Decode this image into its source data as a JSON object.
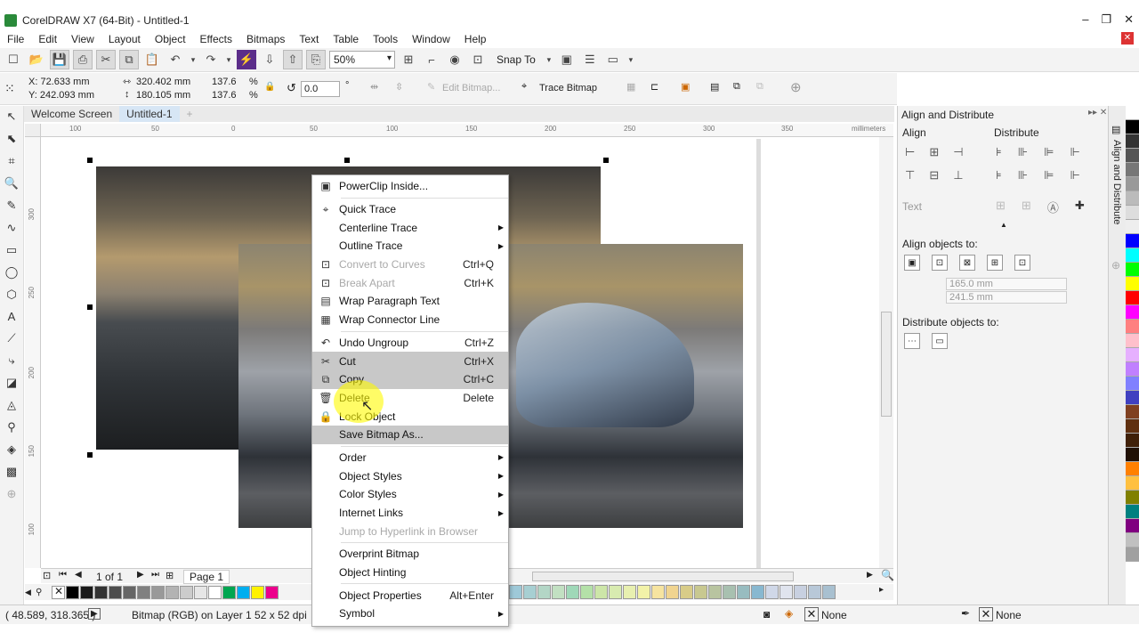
{
  "window": {
    "title": "CorelDRAW X7 (64-Bit) - Untitled-1"
  },
  "menu": [
    "File",
    "Edit",
    "View",
    "Layout",
    "Object",
    "Effects",
    "Bitmaps",
    "Text",
    "Table",
    "Tools",
    "Window",
    "Help"
  ],
  "toolbar": {
    "zoom": "50%",
    "snap_to": "Snap To"
  },
  "property_bar": {
    "x": "X: 72.633 mm",
    "y": "Y: 242.093 mm",
    "width": "320.402 mm",
    "height": "180.105 mm",
    "scale_x": "137.6",
    "scale_y": "137.6",
    "pct": "%",
    "angle": "0.0",
    "deg": "°",
    "edit_bitmap": "Edit Bitmap...",
    "trace_bitmap": "Trace Bitmap"
  },
  "doc_tabs": [
    "Welcome Screen",
    "Untitled-1"
  ],
  "ruler": {
    "h_ticks": [
      "100",
      "50",
      "0",
      "50",
      "100",
      "150",
      "200",
      "250",
      "300",
      "350"
    ],
    "unit": "millimeters",
    "v_ticks": [
      "300",
      "250",
      "200",
      "150",
      "100"
    ],
    "v_unit": "millimeters"
  },
  "page_nav": {
    "counter": "1 of 1",
    "page_tab": "Page 1"
  },
  "context_menu": {
    "items": [
      {
        "label": "PowerClip Inside...",
        "shortcut": "",
        "icon": "powerclip-icon"
      },
      {
        "sep": true
      },
      {
        "label": "Quick Trace",
        "shortcut": "",
        "icon": "quick-trace-icon"
      },
      {
        "label": "Centerline Trace",
        "shortcut": "",
        "submenu": true
      },
      {
        "label": "Outline Trace",
        "shortcut": "",
        "submenu": true
      },
      {
        "label": "Convert to Curves",
        "shortcut": "Ctrl+Q",
        "disabled": true,
        "icon": "convert-curves-icon"
      },
      {
        "label": "Break Apart",
        "shortcut": "Ctrl+K",
        "disabled": true,
        "icon": "break-apart-icon"
      },
      {
        "label": "Wrap Paragraph Text",
        "shortcut": "",
        "icon": "wrap-text-icon"
      },
      {
        "label": "Wrap Connector Line",
        "shortcut": "",
        "icon": "wrap-connector-icon"
      },
      {
        "sep": true
      },
      {
        "label": "Undo Ungroup",
        "shortcut": "Ctrl+Z",
        "icon": "undo-icon"
      },
      {
        "label": "Cut",
        "shortcut": "Ctrl+X",
        "highlight": true,
        "icon": "cut-icon"
      },
      {
        "label": "Copy",
        "shortcut": "Ctrl+C",
        "highlight": true,
        "icon": "copy-icon"
      },
      {
        "label": "Delete",
        "shortcut": "Delete",
        "icon": "trash-icon"
      },
      {
        "label": "Lock Object",
        "shortcut": "",
        "icon": "lock-icon"
      },
      {
        "label": "Save Bitmap As...",
        "shortcut": "",
        "highlight": true
      },
      {
        "sep": true
      },
      {
        "label": "Order",
        "shortcut": "",
        "submenu": true
      },
      {
        "label": "Object Styles",
        "shortcut": "",
        "submenu": true
      },
      {
        "label": "Color Styles",
        "shortcut": "",
        "submenu": true
      },
      {
        "label": "Internet Links",
        "shortcut": "",
        "submenu": true
      },
      {
        "label": "Jump to Hyperlink in Browser",
        "shortcut": "",
        "disabled": true
      },
      {
        "sep": true
      },
      {
        "label": "Overprint Bitmap",
        "shortcut": ""
      },
      {
        "label": "Object Hinting",
        "shortcut": ""
      },
      {
        "sep": true
      },
      {
        "label": "Object Properties",
        "shortcut": "Alt+Enter"
      },
      {
        "label": "Symbol",
        "shortcut": "",
        "submenu": true
      }
    ]
  },
  "docker": {
    "title": "Align and Distribute",
    "align": "Align",
    "distribute": "Distribute",
    "text": "Text",
    "align_to": "Align objects to:",
    "x_value": "165.0 mm",
    "y_value": "241.5 mm",
    "distribute_to": "Distribute objects to:",
    "tab_label": "Align and Distribute"
  },
  "status": {
    "coords": "( 48.589, 318.365 )",
    "info": "Bitmap (RGB) on Layer 1 52 x 52 dpi",
    "fill": "None",
    "outline": "None"
  },
  "palette_colors": [
    "#000000",
    "#1a1a1a",
    "#333333",
    "#4d4d4d",
    "#666666",
    "#808080",
    "#999999",
    "#b3b3b3",
    "#cccccc",
    "#e6e6e6",
    "#ffffff",
    "#00a651",
    "#00aeef",
    "#fff200",
    "#ec008c"
  ],
  "palette_colors_right": [
    "#9ec9d8",
    "#a7cfd2",
    "#b3d6c6",
    "#c2e0c2",
    "#9fd8b8",
    "#b4e1a8",
    "#cde6a8",
    "#d8ebb0",
    "#e8f0b0",
    "#f2f2a8",
    "#f6e4a0",
    "#f0d490",
    "#d8cc88",
    "#c8c890",
    "#b8c4a0",
    "#a8c0b0",
    "#98bcc0",
    "#88b8d0",
    "#d0d8e8",
    "#e0e4ee",
    "#c8d0e0",
    "#b8c8d8",
    "#a8c0d0"
  ],
  "right_palette": [
    "#ffffff",
    "#000000",
    "#333333",
    "#555555",
    "#777777",
    "#999999",
    "#bbbbbb",
    "#dddddd",
    "#eeeeee",
    "#0000ff",
    "#00ffff",
    "#00ff00",
    "#ffff00",
    "#ff0000",
    "#ff00ff",
    "#ff8080",
    "#ffc0cb",
    "#e6b0ff",
    "#c080ff",
    "#8080ff",
    "#4040c0",
    "#804020",
    "#603010",
    "#402008",
    "#201004",
    "#ff8000",
    "#ffc040",
    "#808000",
    "#008080",
    "#800080",
    "#c0c0c0",
    "#a0a0a0"
  ]
}
